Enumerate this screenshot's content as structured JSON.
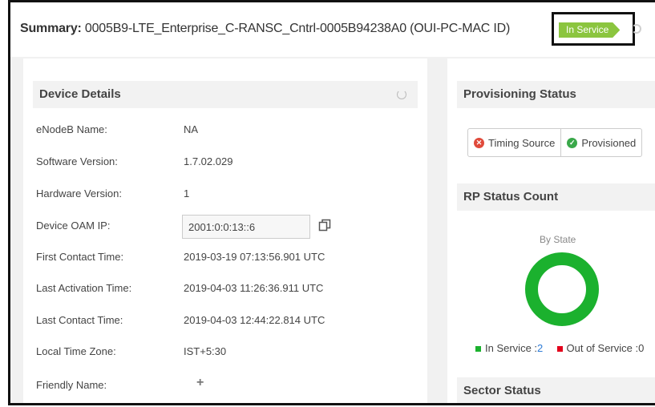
{
  "header": {
    "summary_label": "Summary:",
    "device_id": "0005B9-LTE_Enterprise_C-RANSC_Cntrl-0005B94238A0 (OUI-PC-MAC ID)",
    "status_badge": "In Service",
    "badge_color": "#8bc53f"
  },
  "device_details": {
    "title": "Device Details",
    "rows": [
      {
        "label": "eNodeB Name:",
        "value": "NA"
      },
      {
        "label": "Software Version:",
        "value": "1.7.02.029"
      },
      {
        "label": "Hardware Version:",
        "value": "1"
      },
      {
        "label": "Device OAM IP:",
        "value": "2001:0:0:13::6"
      },
      {
        "label": "First Contact Time:",
        "value": "2019-03-19 07:13:56.901 UTC"
      },
      {
        "label": "Last Activation Time:",
        "value": "2019-04-03 11:26:36.911 UTC"
      },
      {
        "label": "Last Contact Time:",
        "value": "2019-04-03 12:44:22.814 UTC"
      },
      {
        "label": "Local Time Zone:",
        "value": "IST+5:30"
      },
      {
        "label": "Friendly Name:",
        "value": "+"
      }
    ]
  },
  "provisioning_status": {
    "title": "Provisioning Status",
    "items": [
      {
        "label": "Timing Source",
        "icon": "error-x-icon",
        "color": "#e04a3b"
      },
      {
        "label": "Provisioned",
        "icon": "check-icon",
        "color": "#3aa84a"
      }
    ]
  },
  "rp_status_count": {
    "title": "RP Status Count",
    "subtitle": "By State",
    "legend": [
      {
        "label": "In Service :",
        "count": "2",
        "color": "#1bb12e"
      },
      {
        "label": "Out of Service :",
        "count": "0",
        "color": "#e3001b"
      }
    ]
  },
  "chart_data": {
    "type": "pie",
    "title": "By State",
    "categories": [
      "In Service",
      "Out of Service"
    ],
    "values": [
      2,
      0
    ],
    "colors": [
      "#1bb12e",
      "#e3001b"
    ]
  },
  "sector_status": {
    "title": "Sector Status"
  }
}
